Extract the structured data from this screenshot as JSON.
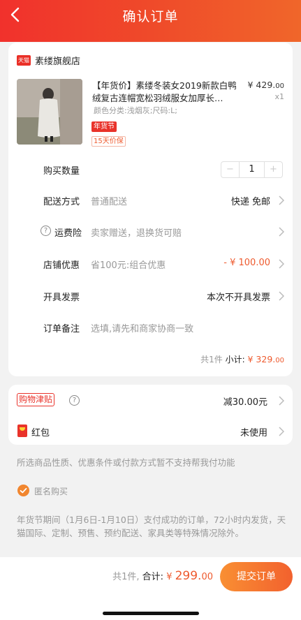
{
  "header": {
    "title": "确认订单"
  },
  "shop": {
    "logo_text": "天猫",
    "name": "素缕旗舰店"
  },
  "product": {
    "title": "【年货价】素缕冬装女2019新款白鸭绒复古连帽宽松羽绒服女加厚长…",
    "price_main": "¥ 429.",
    "price_cents": "00",
    "qty": "x1",
    "sku": "颜色分类:浅烟灰;尺码:L;",
    "tag_festival": "年货节",
    "tag_guarantee": "15天价保"
  },
  "rows": {
    "quantity": {
      "label": "购买数量",
      "value": "1",
      "minus": "−",
      "plus": "+"
    },
    "delivery": {
      "label": "配送方式",
      "sub": "普通配送",
      "value": "快递 免邮"
    },
    "insurance": {
      "label": "运费险",
      "help": "?",
      "sub": "卖家赠送，退换货可赔"
    },
    "discount": {
      "label": "店铺优惠",
      "sub": "省100元:组合优惠",
      "value": "- ¥ 100.00"
    },
    "invoice": {
      "label": "开具发票",
      "value": "本次不开具发票"
    },
    "note": {
      "label": "订单备注",
      "placeholder": "选填,请先和商家协商一致"
    }
  },
  "subtotal": {
    "count": "共1件",
    "label": "小计:",
    "amount_main": "¥ 329.",
    "amount_cents": "00"
  },
  "allowance": {
    "badge": "购物津贴",
    "help": "?",
    "value": "减30.00元"
  },
  "redpacket": {
    "label": "红包",
    "value": "未使用"
  },
  "notice_unsupported": "所选商品性质、优惠条件或付款方式暂不支持帮我付功能",
  "anonymous": {
    "label": "匿名购买",
    "checked": true
  },
  "notice_festival": "年货节期间（1月6日-1月10日）支付成功的订单，72小时内发货，天猫国际、定制、预售、预约配送、家具类等特殊情况除外。",
  "footer": {
    "count": "共1件,",
    "total_label": "合计:",
    "currency": "¥ ",
    "total_main": "299.",
    "total_cents": "00",
    "submit": "提交订单"
  },
  "colors": {
    "header": "#f1312c",
    "accent": "#ee5a2e",
    "submit": "#f2612e"
  }
}
